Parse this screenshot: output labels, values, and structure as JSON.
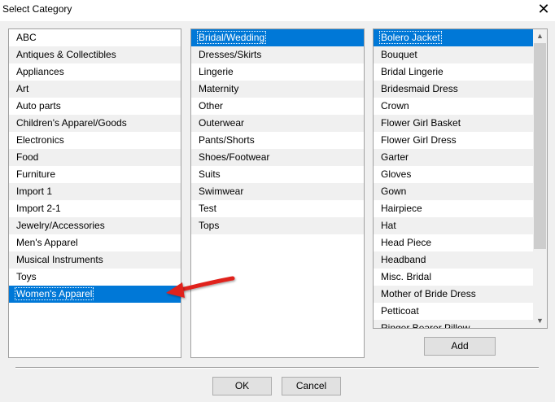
{
  "window": {
    "title": "Select Category",
    "close_glyph": "✕"
  },
  "colors": {
    "selection": "#0078d7",
    "annotation_arrow": "#e0201b"
  },
  "lists": {
    "categories": {
      "items": [
        "ABC",
        "Antiques & Collectibles",
        "Appliances",
        "Art",
        "Auto parts",
        "Children's Apparel/Goods",
        "Electronics",
        "Food",
        "Furniture",
        "Import 1",
        "Import 2-1",
        "Jewelry/Accessories",
        "Men's Apparel",
        "Musical Instruments",
        "Toys",
        "Women's Apparel"
      ],
      "selected": "Women's Apparel"
    },
    "subcategories": {
      "items": [
        "Bridal/Wedding",
        "Dresses/Skirts",
        "Lingerie",
        "Maternity",
        "Other",
        "Outerwear",
        "Pants/Shorts",
        "Shoes/Footwear",
        "Suits",
        "Swimwear",
        "Test",
        "Tops"
      ],
      "selected": "Bridal/Wedding"
    },
    "items": {
      "items": [
        "Bolero Jacket",
        "Bouquet",
        "Bridal Lingerie",
        "Bridesmaid Dress",
        "Crown",
        "Flower Girl Basket",
        "Flower Girl Dress",
        "Garter",
        "Gloves",
        "Gown",
        "Hairpiece",
        "Hat",
        "Head Piece",
        "Headband",
        "Misc. Bridal",
        "Mother of Bride Dress",
        "Petticoat",
        "Ringer Bearer Pillow"
      ],
      "selected": "Bolero Jacket"
    }
  },
  "buttons": {
    "add": "Add",
    "ok": "OK",
    "cancel": "Cancel"
  },
  "icons": {
    "scroll_up": "scroll-up-icon",
    "scroll_down": "scroll-down-icon",
    "arrow": "red-arrow-icon"
  }
}
